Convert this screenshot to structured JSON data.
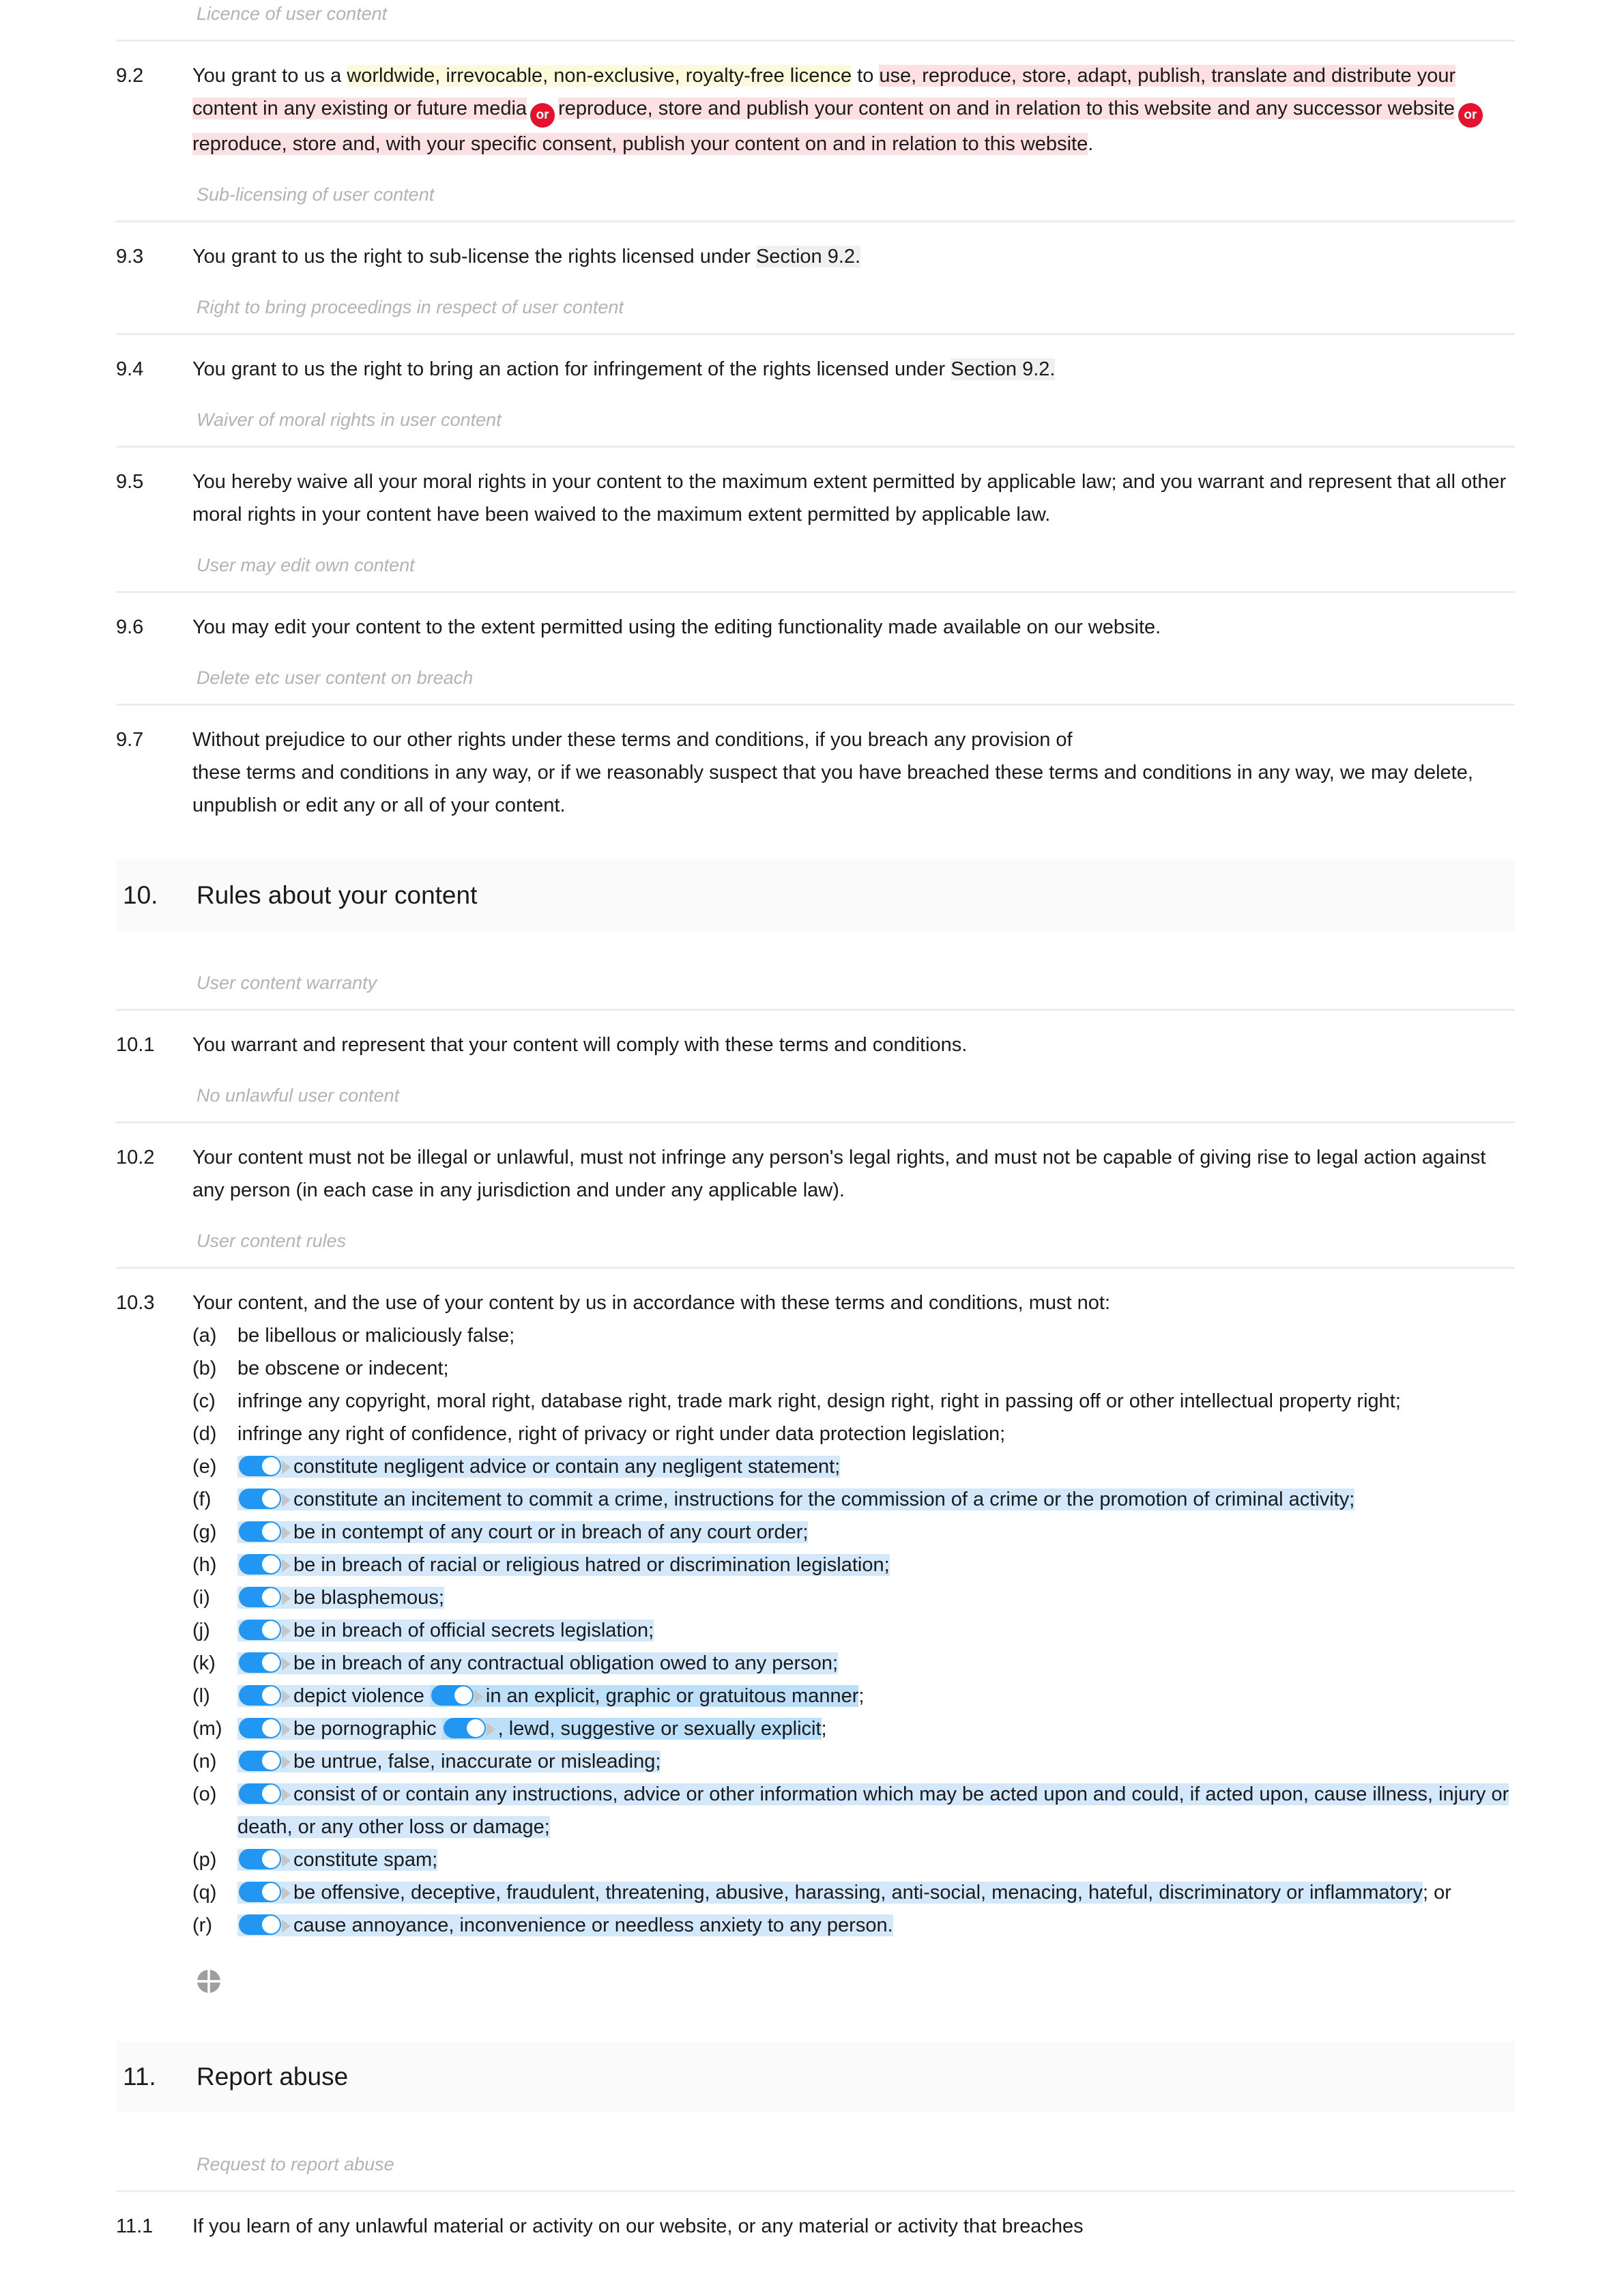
{
  "colors": {
    "highlight_yellow": "#fbfbdc",
    "highlight_pink": "#fce0e2",
    "highlight_blue": "#d3e9fb",
    "highlight_blue_strong": "#bcdffa",
    "highlight_grey": "#f0f0f0",
    "badge_red": "#e8112d",
    "toggle_on": "#2196f3",
    "banner_grey": "#fafafa",
    "caption_grey": "#b3b3b3"
  },
  "clauses": {
    "c92": {
      "number": "9.2",
      "caption": "Licence of user content",
      "part_1": "You grant to us a ",
      "part_2_yellow": "worldwide, irrevocable, non-exclusive, royalty-free licence",
      "part_3": " to ",
      "part_4_pink": "use, reproduce, store, adapt, publish, translate and distribute your content in any existing or future media",
      "badge_1": "or",
      "part_5_pink": "reproduce, store and publish your content on and in relation to this website and any successor website",
      "badge_2": "or",
      "part_6_pink": "reproduce, store and, with your specific consent, publish your content on and in relation to this website",
      "part_7": "."
    },
    "c93": {
      "number": "9.3",
      "caption": "Sub-licensing of user content",
      "text_before_ref": "You grant to us the right to sub-license the rights licensed under ",
      "reference": "Section 9.2.",
      "text_after_ref": ""
    },
    "c94": {
      "number": "9.4",
      "caption": "Right to bring proceedings in respect of user content",
      "text_before_ref": "You grant to us the right to bring an action for infringement of the rights licensed under ",
      "reference": "Section 9.2.",
      "text_after_ref": ""
    },
    "c95": {
      "number": "9.5",
      "caption": "Waiver of moral rights in user content",
      "text": "You hereby waive all your moral rights in your content to the maximum extent permitted by applicable law; and you warrant and represent that all other moral rights in your content have been waived to the maximum extent permitted by applicable law."
    },
    "c96": {
      "number": "9.6",
      "caption": "User may edit own content",
      "text": "You may edit your content to the extent permitted using the editing functionality made available on our website."
    },
    "c97": {
      "number": "9.7",
      "caption": "Delete etc user content on breach",
      "line_1": "Without prejudice to our other rights under these terms and conditions, if you breach any provision of",
      "line_2": "these terms and conditions in any way, or if we reasonably suspect that you have breached these terms and conditions in any way, we may delete, unpublish or edit any or all of your content."
    },
    "c101": {
      "number": "10.1",
      "caption": "User content warranty",
      "text": "You warrant and represent that your content will comply with these terms and conditions."
    },
    "c102": {
      "number": "10.2",
      "caption": "No unlawful user content",
      "text": "Your content must not be illegal or unlawful, must not infringe any person's legal rights, and must not be capable of giving rise to legal action against any person (in each case in any jurisdiction and under any applicable law)."
    },
    "c103": {
      "number": "10.3",
      "caption": "User content rules",
      "lead_in": "Your content, and the use of your content by us in accordance with these terms and conditions, must not:",
      "items": [
        {
          "marker": "(a)",
          "toggle": false,
          "highlight": false,
          "text": "be libellous or maliciously false;"
        },
        {
          "marker": "(b)",
          "toggle": false,
          "highlight": false,
          "text": "be obscene or indecent;"
        },
        {
          "marker": "(c)",
          "toggle": false,
          "highlight": false,
          "text": "infringe any copyright, moral right, database right, trade mark right, design right, right in passing off or other intellectual property right;"
        },
        {
          "marker": "(d)",
          "toggle": false,
          "highlight": false,
          "text": "infringe any right of confidence, right of privacy or right under data protection legislation;"
        },
        {
          "marker": "(e)",
          "toggle": true,
          "highlight": true,
          "text": "constitute negligent advice or contain any negligent statement;"
        },
        {
          "marker": "(f)",
          "toggle": true,
          "highlight": true,
          "text": "constitute an incitement to commit a crime, instructions for the commission of a crime or the promotion of criminal activity;"
        },
        {
          "marker": "(g)",
          "toggle": true,
          "highlight": true,
          "text": "be in contempt of any court or in breach of any court order;"
        },
        {
          "marker": "(h)",
          "toggle": true,
          "highlight": true,
          "text": "be in breach of racial or religious hatred or discrimination legislation;"
        },
        {
          "marker": "(i)",
          "toggle": true,
          "highlight": true,
          "text": "be blasphemous;"
        },
        {
          "marker": "(j)",
          "toggle": true,
          "highlight": true,
          "text": "be in breach of official secrets legislation;"
        },
        {
          "marker": "(k)",
          "toggle": true,
          "highlight": true,
          "text": "be in breach of any contractual obligation owed to any person;"
        },
        {
          "marker": "(l)",
          "toggle": true,
          "highlight": true,
          "nested": true,
          "text_a": "depict violence ",
          "text_b": "in an explicit, graphic or gratuitous manner",
          "text_c": ";"
        },
        {
          "marker": "(m)",
          "toggle": true,
          "highlight": true,
          "nested": true,
          "text_a": "be pornographic ",
          "text_b": ", lewd, suggestive or sexually explicit",
          "text_c": ";"
        },
        {
          "marker": "(n)",
          "toggle": true,
          "highlight": true,
          "text": "be untrue, false, inaccurate or misleading;"
        },
        {
          "marker": "(o)",
          "toggle": true,
          "highlight": true,
          "text": "consist of or contain any instructions, advice or other information which may be acted upon and could, if acted upon, cause illness, injury or death, or any other loss or damage;"
        },
        {
          "marker": "(p)",
          "toggle": true,
          "highlight": true,
          "text": "constitute spam;"
        },
        {
          "marker": "(q)",
          "toggle": true,
          "highlight": true,
          "text_plain_tail": "; or",
          "text": "be offensive, deceptive, fraudulent, threatening, abusive, harassing, anti-social, menacing, hateful, discriminatory or inflammatory"
        },
        {
          "marker": "(r)",
          "toggle": true,
          "highlight": true,
          "text": "cause annoyance, inconvenience or needless anxiety to any person."
        }
      ]
    },
    "c111": {
      "number": "11.1",
      "caption": "Request to report abuse",
      "text": "If you learn of any unlawful material or activity on our website, or any material or activity that breaches"
    }
  },
  "sections": {
    "s10": {
      "number": "10.",
      "title": "Rules about your content"
    },
    "s11": {
      "number": "11.",
      "title": "Report abuse"
    }
  },
  "icons": {
    "quadrant_circle": "quadrant-circle-icon",
    "toggle_on": "toggle-switch-on-icon",
    "expand_arrow": "expand-arrow-icon",
    "or_badge": "or-alternative-badge"
  }
}
